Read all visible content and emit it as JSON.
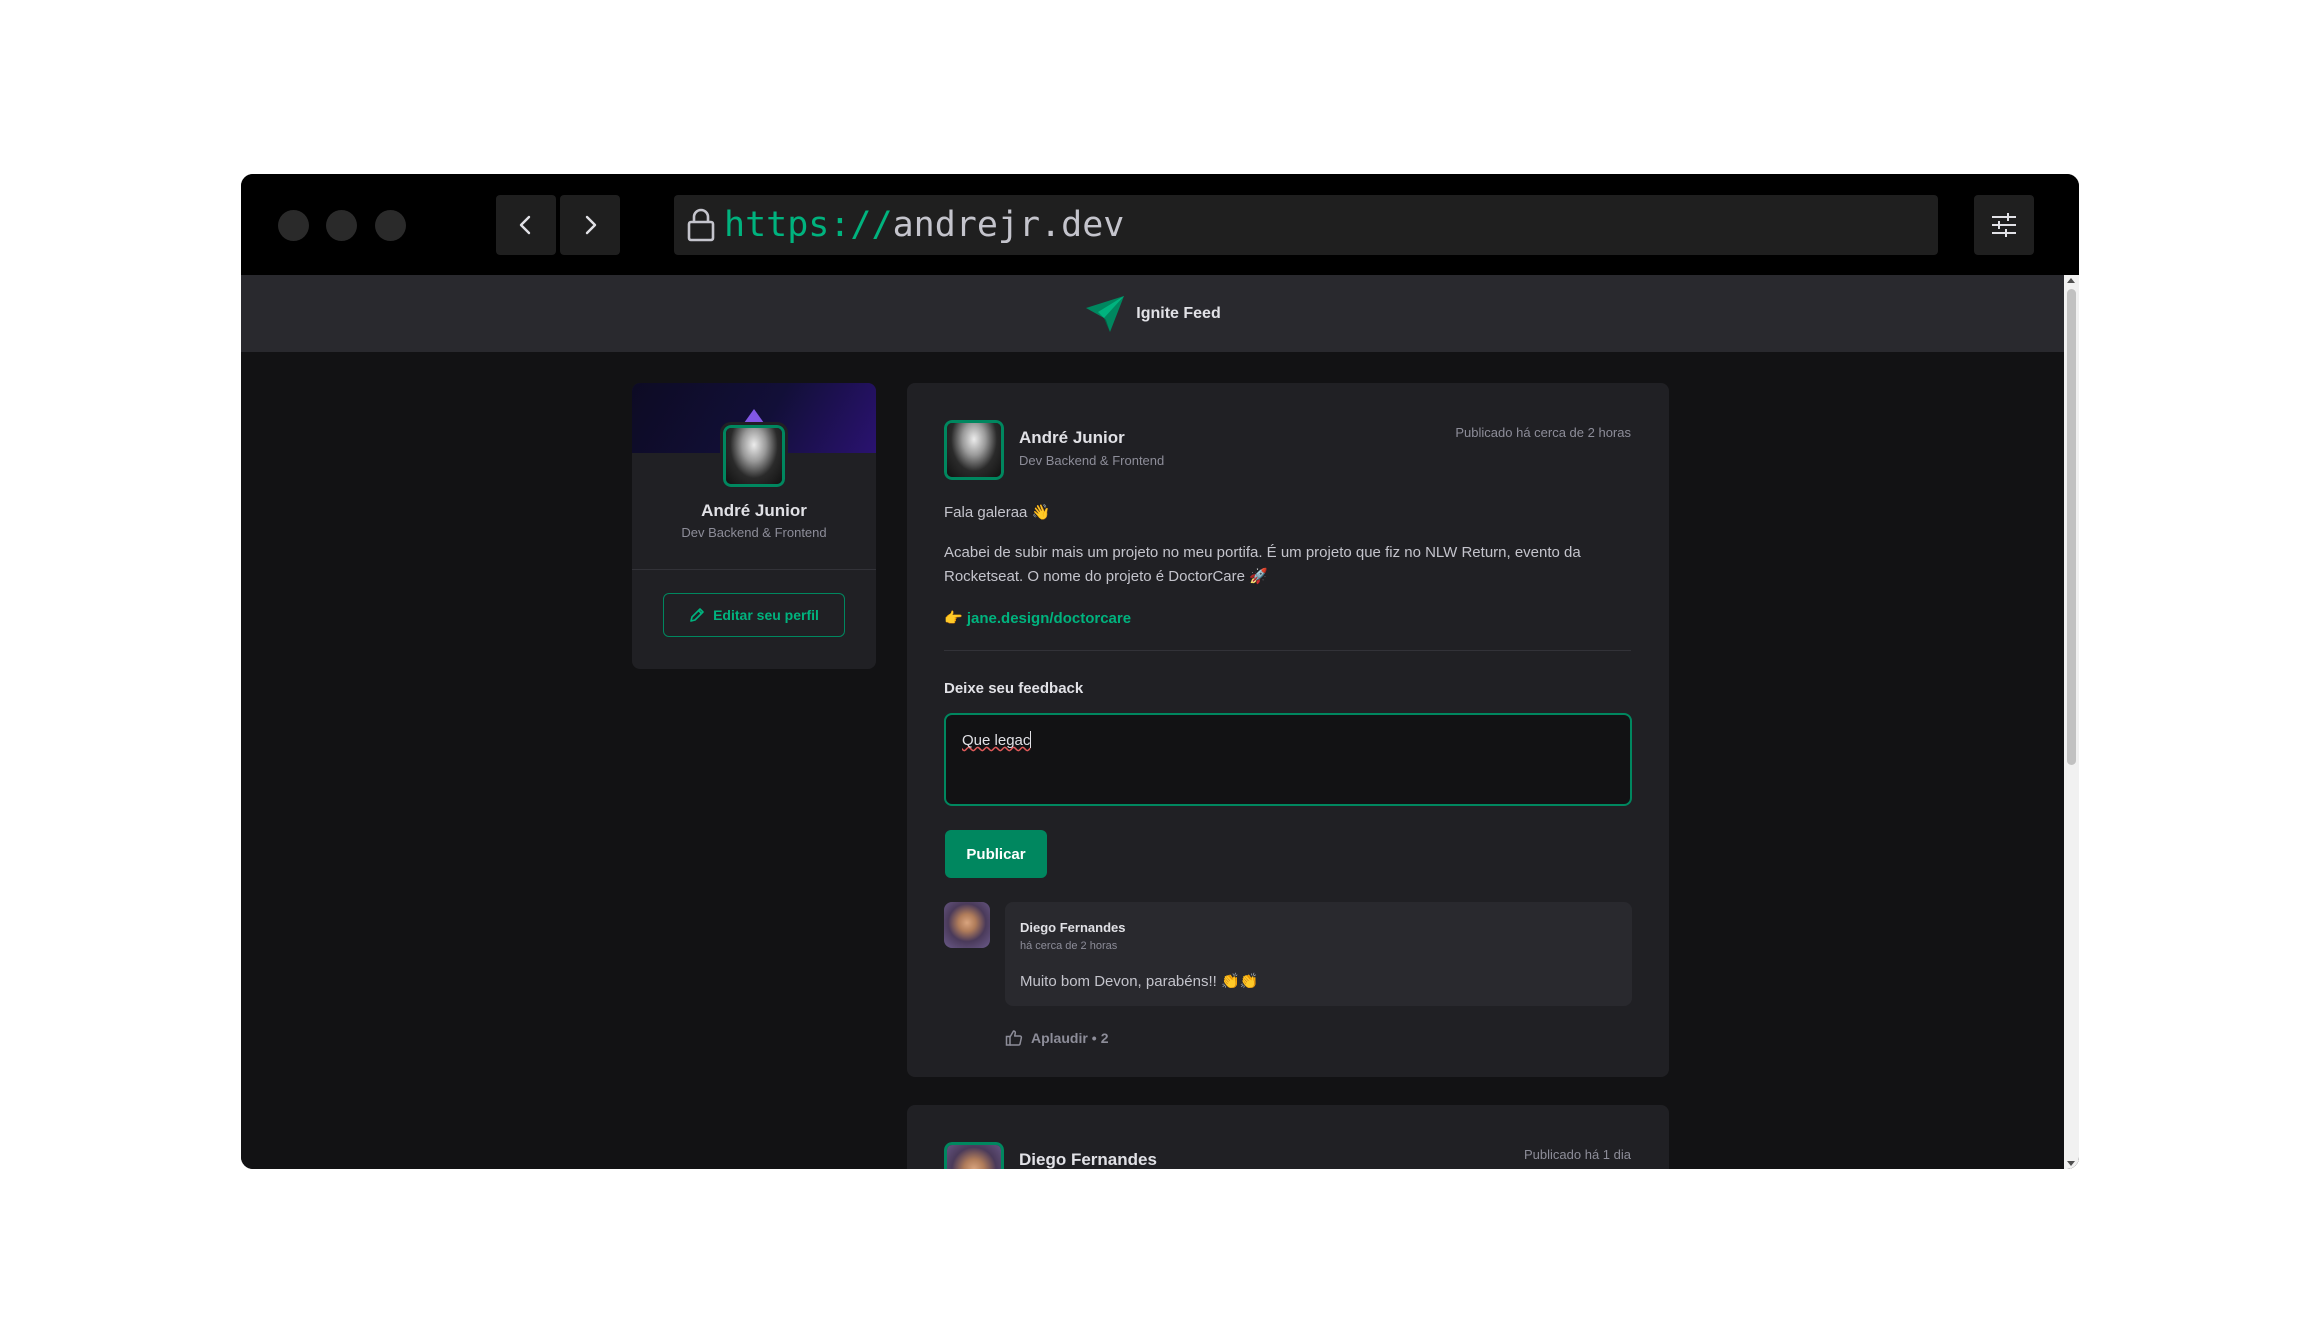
{
  "browser": {
    "url_protocol": "https://",
    "url_host": "andrejr.dev"
  },
  "app": {
    "title": "Ignite Feed"
  },
  "sidebar": {
    "name": "André Junior",
    "role": "Dev Backend & Frontend",
    "edit_label": "Editar seu perfil"
  },
  "post1": {
    "author": "André Junior",
    "role": "Dev Backend & Frontend",
    "published": "Publicado há cerca de 2 horas",
    "greeting": "Fala galeraa 👋",
    "body_line1": "Acabei de subir mais um projeto no meu portifa. É um projeto que fiz no NLW Return, evento da",
    "body_line2": "Rocketseat. O nome do projeto é DoctorCare 🚀",
    "link_prefix": "👉",
    "link": "jane.design/doctorcare",
    "feedback_title": "Deixe seu feedback",
    "feedback_value": "Que legac",
    "publish_label": "Publicar"
  },
  "comment": {
    "author": "Diego Fernandes",
    "time": "há cerca de 2 horas",
    "text": "Muito bom Devon, parabéns!! 👏👏",
    "applaud_label": "Aplaudir",
    "applaud_separator": "•",
    "applaud_count": "2"
  },
  "post2": {
    "author": "Diego Fernandes",
    "published": "Publicado há 1 dia"
  },
  "colors": {
    "accent": "#00875f",
    "accent_light": "#00b37e",
    "background": "#121214",
    "card": "#202024",
    "header": "#29292e"
  }
}
